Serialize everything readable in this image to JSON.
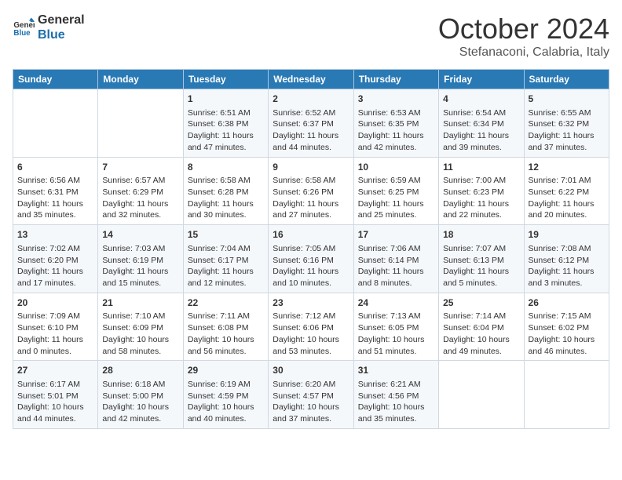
{
  "header": {
    "logo_line1": "General",
    "logo_line2": "Blue",
    "month": "October 2024",
    "location": "Stefanaconi, Calabria, Italy"
  },
  "days_of_week": [
    "Sunday",
    "Monday",
    "Tuesday",
    "Wednesday",
    "Thursday",
    "Friday",
    "Saturday"
  ],
  "weeks": [
    [
      {
        "day": "",
        "content": ""
      },
      {
        "day": "",
        "content": ""
      },
      {
        "day": "1",
        "content": "Sunrise: 6:51 AM\nSunset: 6:38 PM\nDaylight: 11 hours\nand 47 minutes."
      },
      {
        "day": "2",
        "content": "Sunrise: 6:52 AM\nSunset: 6:37 PM\nDaylight: 11 hours\nand 44 minutes."
      },
      {
        "day": "3",
        "content": "Sunrise: 6:53 AM\nSunset: 6:35 PM\nDaylight: 11 hours\nand 42 minutes."
      },
      {
        "day": "4",
        "content": "Sunrise: 6:54 AM\nSunset: 6:34 PM\nDaylight: 11 hours\nand 39 minutes."
      },
      {
        "day": "5",
        "content": "Sunrise: 6:55 AM\nSunset: 6:32 PM\nDaylight: 11 hours\nand 37 minutes."
      }
    ],
    [
      {
        "day": "6",
        "content": "Sunrise: 6:56 AM\nSunset: 6:31 PM\nDaylight: 11 hours\nand 35 minutes."
      },
      {
        "day": "7",
        "content": "Sunrise: 6:57 AM\nSunset: 6:29 PM\nDaylight: 11 hours\nand 32 minutes."
      },
      {
        "day": "8",
        "content": "Sunrise: 6:58 AM\nSunset: 6:28 PM\nDaylight: 11 hours\nand 30 minutes."
      },
      {
        "day": "9",
        "content": "Sunrise: 6:58 AM\nSunset: 6:26 PM\nDaylight: 11 hours\nand 27 minutes."
      },
      {
        "day": "10",
        "content": "Sunrise: 6:59 AM\nSunset: 6:25 PM\nDaylight: 11 hours\nand 25 minutes."
      },
      {
        "day": "11",
        "content": "Sunrise: 7:00 AM\nSunset: 6:23 PM\nDaylight: 11 hours\nand 22 minutes."
      },
      {
        "day": "12",
        "content": "Sunrise: 7:01 AM\nSunset: 6:22 PM\nDaylight: 11 hours\nand 20 minutes."
      }
    ],
    [
      {
        "day": "13",
        "content": "Sunrise: 7:02 AM\nSunset: 6:20 PM\nDaylight: 11 hours\nand 17 minutes."
      },
      {
        "day": "14",
        "content": "Sunrise: 7:03 AM\nSunset: 6:19 PM\nDaylight: 11 hours\nand 15 minutes."
      },
      {
        "day": "15",
        "content": "Sunrise: 7:04 AM\nSunset: 6:17 PM\nDaylight: 11 hours\nand 12 minutes."
      },
      {
        "day": "16",
        "content": "Sunrise: 7:05 AM\nSunset: 6:16 PM\nDaylight: 11 hours\nand 10 minutes."
      },
      {
        "day": "17",
        "content": "Sunrise: 7:06 AM\nSunset: 6:14 PM\nDaylight: 11 hours\nand 8 minutes."
      },
      {
        "day": "18",
        "content": "Sunrise: 7:07 AM\nSunset: 6:13 PM\nDaylight: 11 hours\nand 5 minutes."
      },
      {
        "day": "19",
        "content": "Sunrise: 7:08 AM\nSunset: 6:12 PM\nDaylight: 11 hours\nand 3 minutes."
      }
    ],
    [
      {
        "day": "20",
        "content": "Sunrise: 7:09 AM\nSunset: 6:10 PM\nDaylight: 11 hours\nand 0 minutes."
      },
      {
        "day": "21",
        "content": "Sunrise: 7:10 AM\nSunset: 6:09 PM\nDaylight: 10 hours\nand 58 minutes."
      },
      {
        "day": "22",
        "content": "Sunrise: 7:11 AM\nSunset: 6:08 PM\nDaylight: 10 hours\nand 56 minutes."
      },
      {
        "day": "23",
        "content": "Sunrise: 7:12 AM\nSunset: 6:06 PM\nDaylight: 10 hours\nand 53 minutes."
      },
      {
        "day": "24",
        "content": "Sunrise: 7:13 AM\nSunset: 6:05 PM\nDaylight: 10 hours\nand 51 minutes."
      },
      {
        "day": "25",
        "content": "Sunrise: 7:14 AM\nSunset: 6:04 PM\nDaylight: 10 hours\nand 49 minutes."
      },
      {
        "day": "26",
        "content": "Sunrise: 7:15 AM\nSunset: 6:02 PM\nDaylight: 10 hours\nand 46 minutes."
      }
    ],
    [
      {
        "day": "27",
        "content": "Sunrise: 6:17 AM\nSunset: 5:01 PM\nDaylight: 10 hours\nand 44 minutes."
      },
      {
        "day": "28",
        "content": "Sunrise: 6:18 AM\nSunset: 5:00 PM\nDaylight: 10 hours\nand 42 minutes."
      },
      {
        "day": "29",
        "content": "Sunrise: 6:19 AM\nSunset: 4:59 PM\nDaylight: 10 hours\nand 40 minutes."
      },
      {
        "day": "30",
        "content": "Sunrise: 6:20 AM\nSunset: 4:57 PM\nDaylight: 10 hours\nand 37 minutes."
      },
      {
        "day": "31",
        "content": "Sunrise: 6:21 AM\nSunset: 4:56 PM\nDaylight: 10 hours\nand 35 minutes."
      },
      {
        "day": "",
        "content": ""
      },
      {
        "day": "",
        "content": ""
      }
    ]
  ]
}
